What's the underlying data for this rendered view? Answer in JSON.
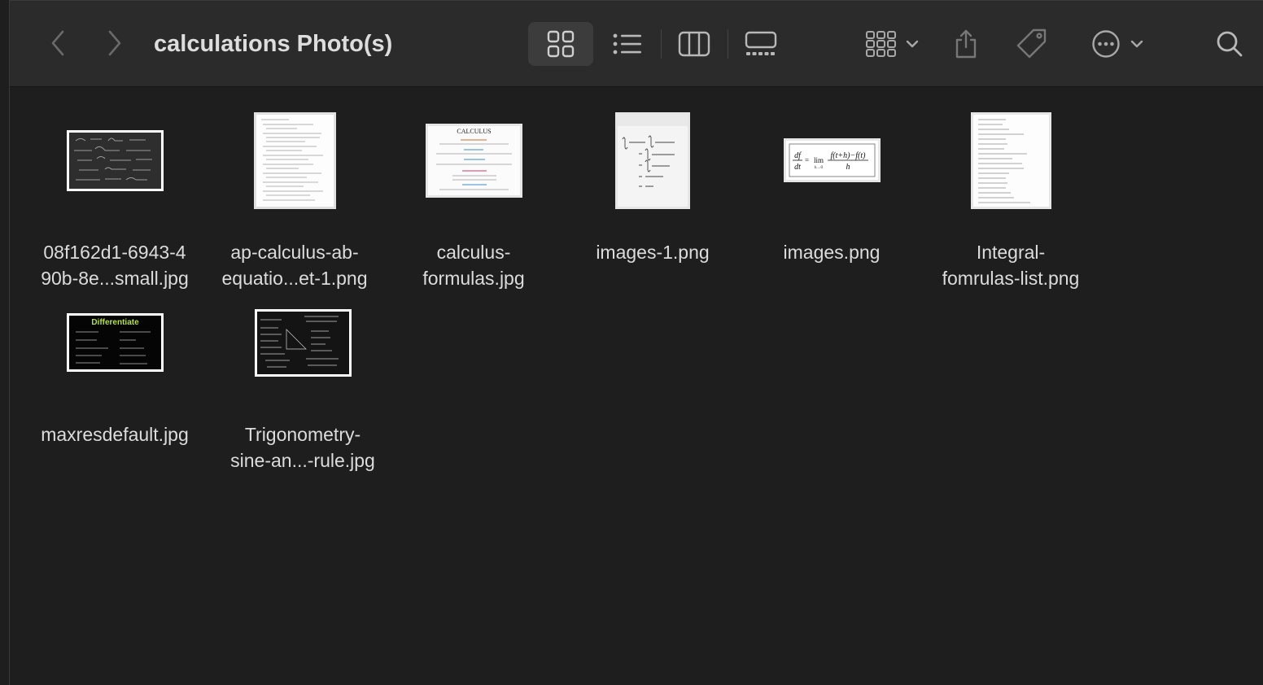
{
  "window": {
    "title": "calculations Photo(s)"
  },
  "toolbar": {
    "back_icon": "chevron-left-icon",
    "forward_icon": "chevron-right-icon",
    "views": [
      "icon-view-icon",
      "list-view-icon",
      "column-view-icon",
      "gallery-view-icon"
    ],
    "selected_view": "icon-view-icon",
    "group_icon": "group-grid-icon",
    "share_icon": "share-icon",
    "tag_icon": "tag-icon",
    "more_icon": "ellipsis-circle-icon",
    "search_icon": "search-icon"
  },
  "files": [
    {
      "name": "08f162d1-6943-4\n90b-8e...small.jpg",
      "thumb": "dark-chalkboard"
    },
    {
      "name": "ap-calculus-ab-\nequatio...et-1.png",
      "thumb": "white-document"
    },
    {
      "name": "calculus-\nformulas.jpg",
      "thumb": "calculus-sheet"
    },
    {
      "name": "images-1.png",
      "thumb": "integral-white"
    },
    {
      "name": "images.png",
      "thumb": "derivative-definition"
    },
    {
      "name": "Integral-\nfomrulas-list.png",
      "thumb": "integral-list"
    },
    {
      "name": "maxresdefault.jpg",
      "thumb": "differentiate-dark"
    },
    {
      "name": "Trigonometry-\nsine-an...-rule.jpg",
      "thumb": "trig-dark"
    }
  ],
  "thumb_text": {
    "calculus_title": "CALCULUS",
    "differentiate_title": "Differentiate",
    "derivative_lhs": "df",
    "derivative_den": "dt",
    "derivative_lim": "lim",
    "derivative_num": "f(t+h)−f(t)",
    "derivative_h": "h"
  },
  "colors": {
    "toolbar_bg": "#2b2b2b",
    "content_bg": "#1e1e1e",
    "selected_view_bg": "#3c3c3c",
    "differentiate_green": "#b6e23a"
  }
}
